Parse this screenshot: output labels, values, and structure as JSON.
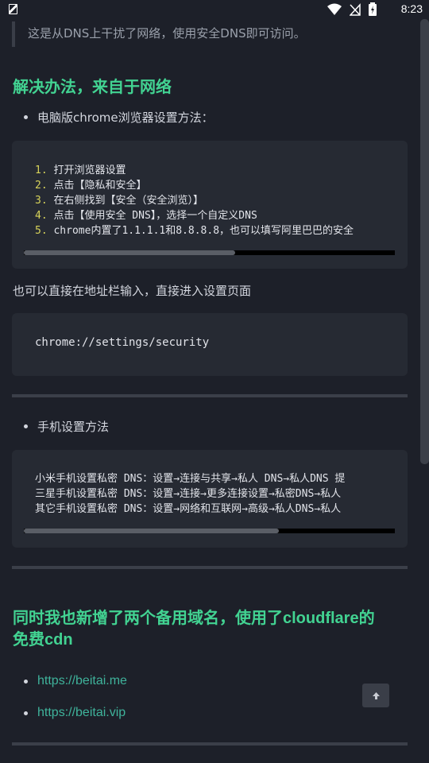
{
  "status_bar": {
    "time": "8:23",
    "icons": [
      "app-notification-icon",
      "wifi-icon",
      "no-signal-icon",
      "battery-icon"
    ]
  },
  "quote": {
    "text": "这是从DNS上干扰了网络，使用安全DNS即可访问。"
  },
  "section1": {
    "heading": "解决办法，来自于网络",
    "pc_bullet": "电脑版chrome浏览器设置方法：",
    "steps": [
      {
        "num": "1.",
        "text": "打开浏览器设置"
      },
      {
        "num": "2.",
        "text": "点击【隐私和安全】"
      },
      {
        "num": "3.",
        "text": "在右侧找到【安全（安全浏览）】"
      },
      {
        "num": "4.",
        "text": "点击【使用安全 DNS】，选择一个自定义DNS"
      },
      {
        "num": "5.",
        "text": "chrome内置了1.1.1.1和8.8.8.8，也可以填写阿里巴巴的安全"
      }
    ],
    "address_hint": "也可以直接在地址栏输入，直接进入设置页面",
    "address_code": "chrome://settings/security",
    "mobile_bullet": "手机设置方法",
    "mobile_lines": [
      "小米手机设置私密 DNS：设置→连接与共享→私人 DNS→私人DNS 提",
      "三星手机设置私密 DNS：设置→连接→更多连接设置→私密DNS→私人",
      "其它手机设置私密 DNS：设置→网络和互联网→高级→私人DNS→私人"
    ]
  },
  "section2": {
    "heading_line1_prefix": "同时我也新增了两个备用域名，使用了",
    "heading_line1_bold": "cloudflare",
    "heading_line1_suffix": "的",
    "heading_line2_prefix": "免费",
    "heading_line2_bold": "cdn",
    "links": [
      "https://beitai.me",
      "https://beitai.vip"
    ]
  },
  "colors": {
    "background": "#1d2029",
    "heading": "#42d392",
    "link": "#3fb39b",
    "code_bg": "#262a33"
  }
}
